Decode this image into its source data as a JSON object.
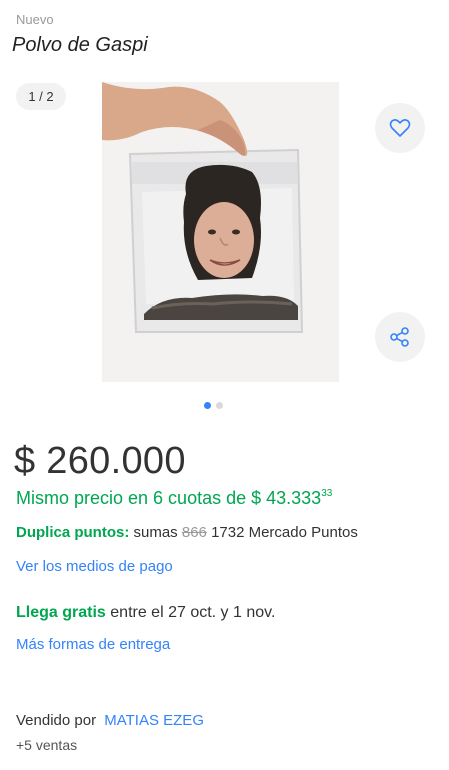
{
  "item": {
    "condition": "Nuevo",
    "title": "Polvo de Gaspi"
  },
  "gallery": {
    "counter": "1 / 2",
    "image_count": 2,
    "active_index": 0,
    "favorite_icon": "heart-outline-icon",
    "share_icon": "share-icon"
  },
  "pricing": {
    "price": "$ 260.000",
    "installments_text": "Mismo precio en 6 cuotas de $ 43.333",
    "installments_cents": "33",
    "points_label": "Duplica puntos:",
    "points_prefix": "sumas",
    "points_old": "866",
    "points_new": "1732 Mercado Puntos",
    "payment_link": "Ver los medios de pago"
  },
  "shipping": {
    "free_label": "Llega gratis",
    "dates": "entre el 27 oct. y 1 nov.",
    "more_link": "Más formas de entrega"
  },
  "seller": {
    "label": "Vendido por",
    "name": "MATIAS EZEG",
    "sales": "+5 ventas"
  },
  "colors": {
    "accent_blue": "#3483fa",
    "green": "#00a650"
  }
}
